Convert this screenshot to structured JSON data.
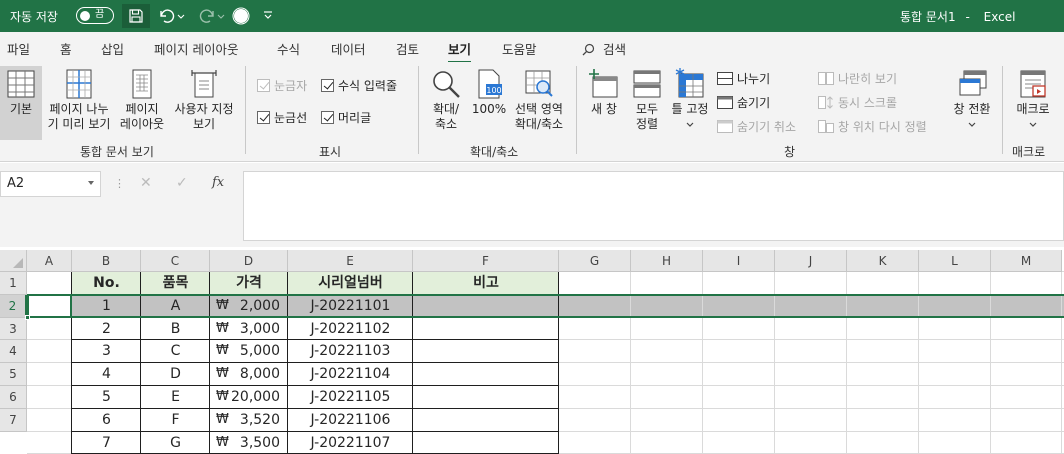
{
  "titlebar": {
    "autosave_label": "자동 저장",
    "autosave_state": "끔",
    "document_title": "통합 문서1",
    "separator": "-",
    "app_name": "Excel",
    "bg_color": "#217346"
  },
  "tabs": [
    "파일",
    "홈",
    "삽입",
    "페이지 레이아웃",
    "수식",
    "데이터",
    "검토",
    "보기",
    "도움말"
  ],
  "active_tab": "보기",
  "search_label": "검색",
  "ribbon": {
    "workbook_views": {
      "normal": "기본",
      "page_break_1": "페이지 나누",
      "page_break_2": "기 미리 보기",
      "page_layout_1": "페이지",
      "page_layout_2": "레이아웃",
      "custom_1": "사용자 지정",
      "custom_2": "보기",
      "group": "통합 문서 보기"
    },
    "show": {
      "ruler": "눈금자",
      "formula_bar": "수식 입력줄",
      "gridlines": "눈금선",
      "headings": "머리글",
      "group": "표시"
    },
    "zoom": {
      "zoom_1": "확대/",
      "zoom_2": "축소",
      "hundred": "100%",
      "sel_1": "선택 영역",
      "sel_2": "확대/축소",
      "group": "확대/축소",
      "icon_100": "100"
    },
    "window": {
      "new_window_1": "새 창",
      "arrange_1": "모두",
      "arrange_2": "정렬",
      "freeze": "틀 고정",
      "split": "나누기",
      "hide": "숨기기",
      "unhide": "숨기기 취소",
      "side_by_side": "나란히 보기",
      "sync_scroll": "동시 스크롤",
      "reset_pos": "창 위치 다시 정렬",
      "switch": "창 전환",
      "group": "창"
    },
    "macros": {
      "macro": "매크로",
      "group": "매크로"
    }
  },
  "formula_bar": {
    "name_box": "A2",
    "cancel": "✕",
    "enter": "✓",
    "fx": "fx",
    "formula": ""
  },
  "columns": [
    "A",
    "B",
    "C",
    "D",
    "E",
    "F",
    "G",
    "H",
    "I",
    "J",
    "K",
    "L",
    "M"
  ],
  "rows": [
    "1",
    "2",
    "3",
    "4",
    "5",
    "6",
    "7"
  ],
  "sheet": {
    "header": [
      "No.",
      "품목",
      "가격",
      "시리얼넘버",
      "비고"
    ],
    "currency_symbol": "₩",
    "data": [
      [
        "1",
        "A",
        "2,000",
        "J-20221101"
      ],
      [
        "2",
        "B",
        "3,000",
        "J-20221102"
      ],
      [
        "3",
        "C",
        "5,000",
        "J-20221103"
      ],
      [
        "4",
        "D",
        "8,000",
        "J-20221104"
      ],
      [
        "5",
        "E",
        "20,000",
        "J-20221105"
      ],
      [
        "6",
        "F",
        "3,520",
        "J-20221106"
      ],
      [
        "7",
        "G",
        "3,500",
        "J-20221107"
      ]
    ],
    "header_fill": "#e2efda",
    "selected_row_fill": "#c2c2c2",
    "accent": "#217346"
  }
}
